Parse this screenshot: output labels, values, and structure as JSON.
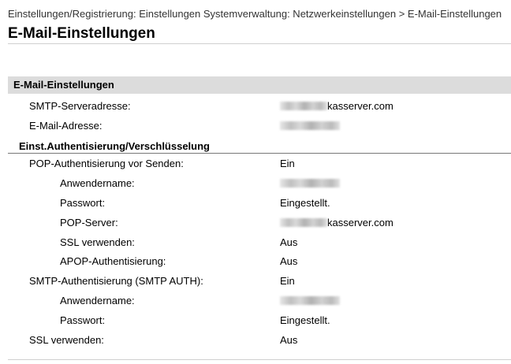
{
  "breadcrumb": "Einstellungen/Registrierung: Einstellungen Systemverwaltung: Netzwerkeinstellungen > E-Mail-Einstellungen",
  "page_title": "E-Mail-Einstellungen",
  "section": {
    "title": "E-Mail-Einstellungen",
    "smtp_server": {
      "label": "SMTP-Serveradresse:",
      "value_suffix": "kasserver.com"
    },
    "email_address": {
      "label": "E-Mail-Adresse:"
    }
  },
  "auth_group": {
    "title": "Einst.Authentisierung/Verschlüsselung",
    "pop_before_send": {
      "label": "POP-Authentisierung vor Senden:",
      "value": "Ein"
    },
    "pop_username": {
      "label": "Anwendername:"
    },
    "pop_password": {
      "label": "Passwort:",
      "value": "Eingestellt."
    },
    "pop_server": {
      "label": "POP-Server:",
      "value_suffix": "kasserver.com"
    },
    "pop_ssl": {
      "label": "SSL verwenden:",
      "value": "Aus"
    },
    "apop": {
      "label": "APOP-Authentisierung:",
      "value": "Aus"
    },
    "smtp_auth": {
      "label": "SMTP-Authentisierung (SMTP AUTH):",
      "value": "Ein"
    },
    "smtp_username": {
      "label": "Anwendername:"
    },
    "smtp_password": {
      "label": "Passwort:",
      "value": "Eingestellt."
    },
    "ssl": {
      "label": "SSL verwenden:",
      "value": "Aus"
    }
  }
}
